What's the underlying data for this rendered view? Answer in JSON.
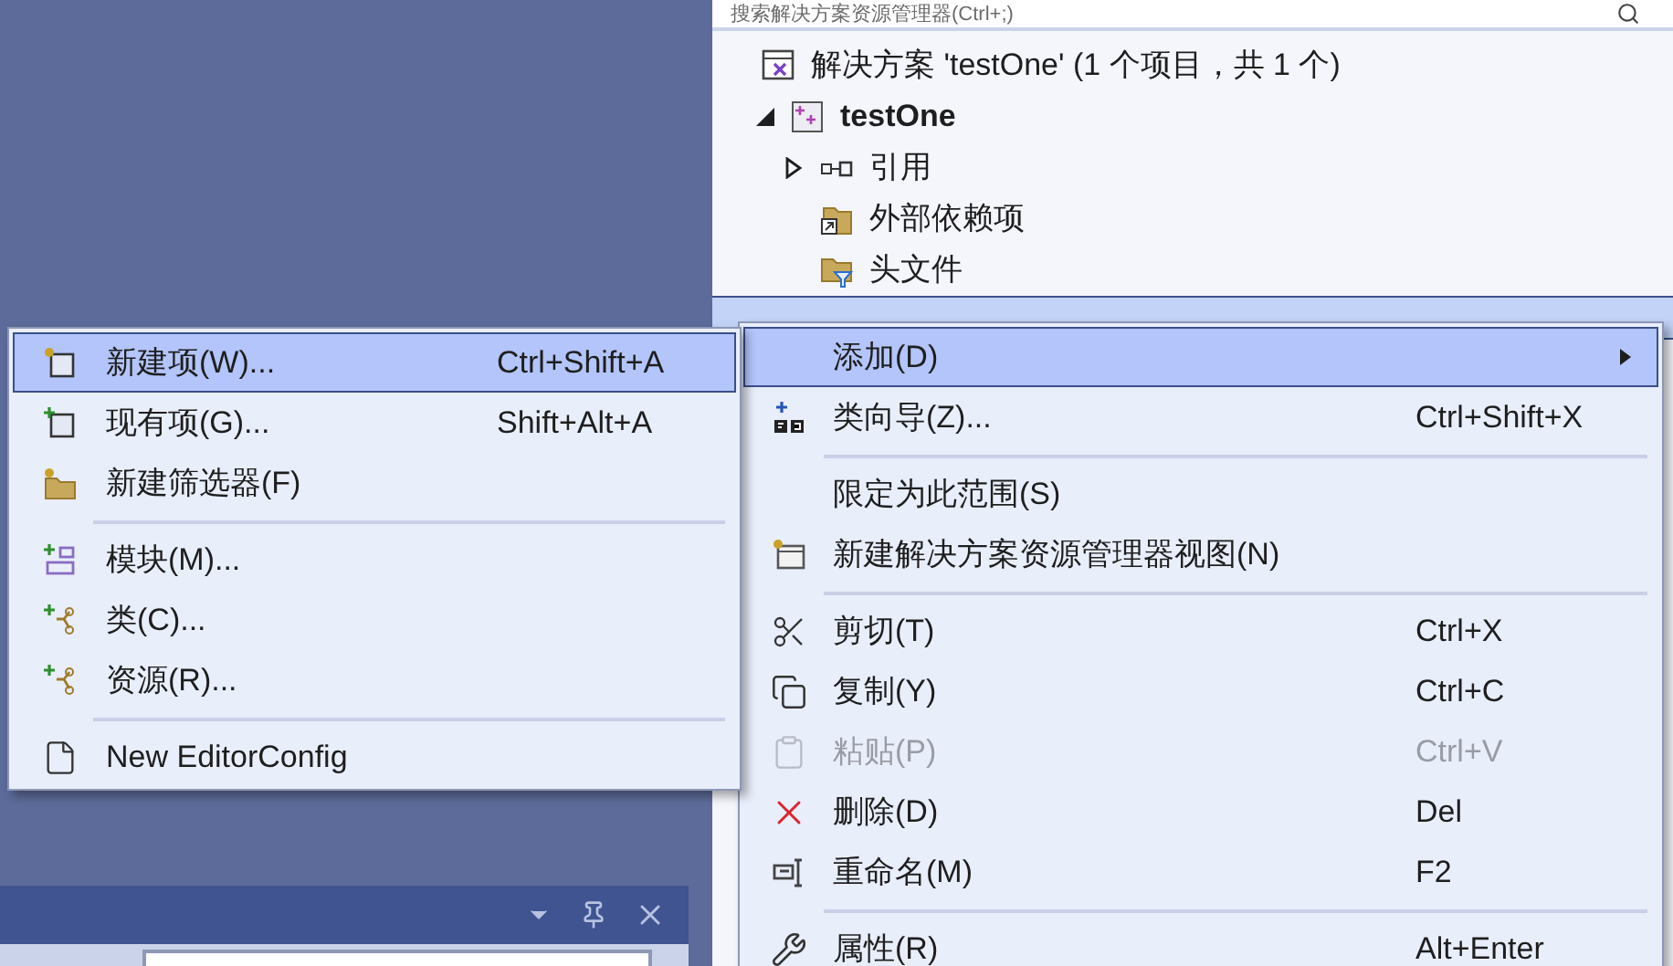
{
  "explorer": {
    "search": {
      "placeholder": "搜索解决方案资源管理器(Ctrl+;)"
    },
    "tree": {
      "label": "解决方案 'testOne' (1 个项目，共 1 个)",
      "children": [
        {
          "label": "testOne",
          "expanded": true,
          "children": [
            {
              "label": "引用",
              "expanded": false
            },
            {
              "label": "外部依赖项"
            },
            {
              "label": "头文件"
            }
          ]
        }
      ]
    },
    "selected_row": {
      "selected": true
    }
  },
  "context_menu": {
    "groups": [
      [
        {
          "label": "添加(D)",
          "selected": true,
          "disabled": false,
          "submenu": true
        },
        {
          "label": "类向导(Z)...",
          "shortcut": "Ctrl+Shift+X",
          "selected": false,
          "disabled": false
        }
      ],
      [
        {
          "label": "限定为此范围(S)",
          "selected": false,
          "disabled": false
        },
        {
          "label": "新建解决方案资源管理器视图(N)",
          "selected": false,
          "disabled": false
        }
      ],
      [
        {
          "label": "剪切(T)",
          "shortcut": "Ctrl+X",
          "selected": false,
          "disabled": false
        },
        {
          "label": "复制(Y)",
          "shortcut": "Ctrl+C",
          "selected": false,
          "disabled": false
        },
        {
          "label": "粘贴(P)",
          "shortcut": "Ctrl+V",
          "selected": false,
          "disabled": true
        },
        {
          "label": "删除(D)",
          "shortcut": "Del",
          "selected": false,
          "disabled": false
        },
        {
          "label": "重命名(M)",
          "shortcut": "F2",
          "selected": false,
          "disabled": false
        }
      ],
      [
        {
          "label": "属性(R)",
          "shortcut": "Alt+Enter",
          "selected": false,
          "disabled": false
        }
      ]
    ]
  },
  "submenu": {
    "groups": [
      [
        {
          "label": "新建项(W)...",
          "shortcut": "Ctrl+Shift+A",
          "selected": true
        },
        {
          "label": "现有项(G)...",
          "shortcut": "Shift+Alt+A",
          "selected": false
        },
        {
          "label": "新建筛选器(F)",
          "selected": false
        }
      ],
      [
        {
          "label": "模块(M)...",
          "selected": false
        },
        {
          "label": "类(C)...",
          "selected": false
        },
        {
          "label": "资源(R)...",
          "selected": false
        }
      ],
      [
        {
          "label": "New EditorConfig",
          "selected": false
        }
      ]
    ]
  }
}
